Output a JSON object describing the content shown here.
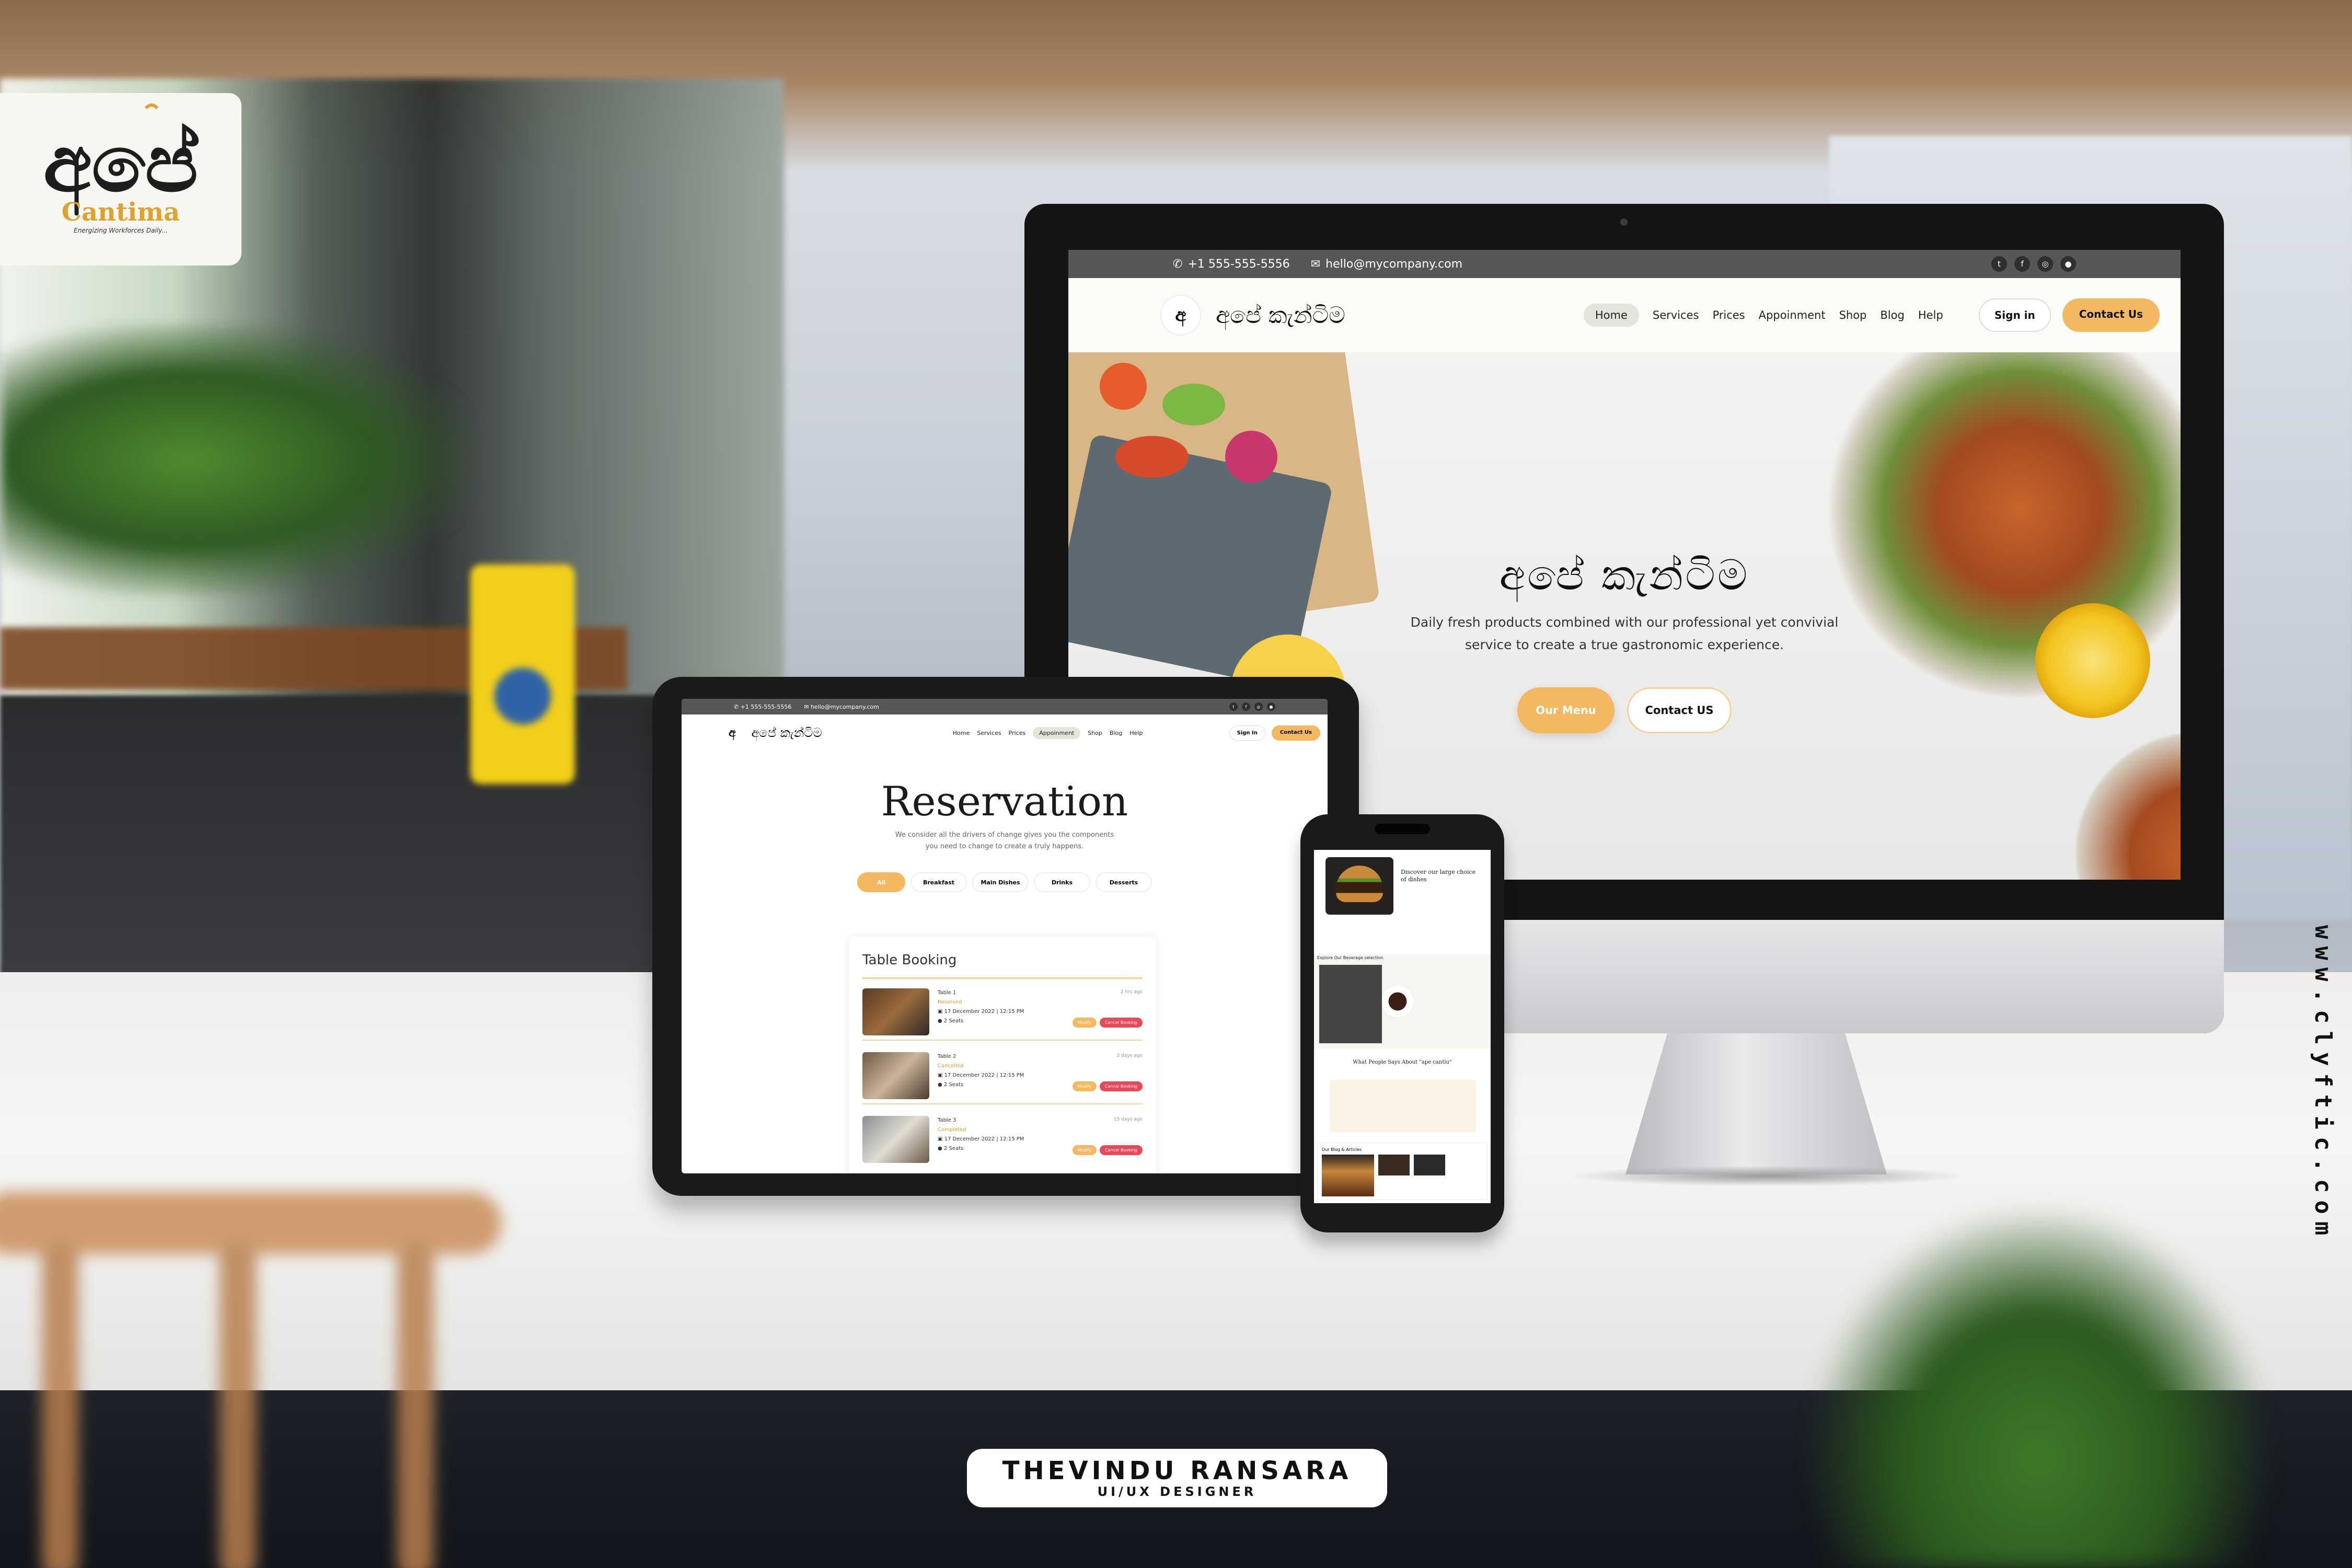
{
  "brand": {
    "glyph": "අපේ",
    "name": "Cantima",
    "tagline": "Energizing Workforces Daily..."
  },
  "side_url": "www.clyftic.com",
  "designer": {
    "name": "THEVINDU RANSARA",
    "role": "UI/UX DESIGNER"
  },
  "desktop": {
    "topbar": {
      "phone": "+1 555-555-5556",
      "email": "hello@mycompany.com",
      "social": [
        "twitter-icon",
        "facebook-icon",
        "instagram-icon",
        "github-icon"
      ]
    },
    "nav": {
      "logo_text": "අපේ කැන්ටිම",
      "items": [
        "Home",
        "Services",
        "Prices",
        "Appoinment",
        "Shop",
        "Blog",
        "Help"
      ],
      "active": "Home",
      "signin": "Sign in",
      "contact": "Contact Us"
    },
    "hero": {
      "title": "අපේ කැන්ටිම",
      "subtitle_line1": "Daily fresh products combined with our professional yet convivial",
      "subtitle_line2": "service to create a true gastronomic experience.",
      "btn_menu": "Our Menu",
      "btn_contact": "Contact US"
    },
    "accent": "#f4b860"
  },
  "tablet": {
    "topbar": {
      "phone": "+1 555-555-5556",
      "email": "hello@mycompany.com"
    },
    "nav": {
      "logo_text": "අපේ කැන්ටිම",
      "items": [
        "Home",
        "Services",
        "Prices",
        "Appoinment",
        "Shop",
        "Blog",
        "Help"
      ],
      "active": "Appoinment",
      "signin": "Sign In",
      "contact": "Contact Us"
    },
    "title": "Reservation",
    "subtitle_line1": "We consider all the drivers of change gives you the components",
    "subtitle_line2": "you need to change to create a truly happens.",
    "tabs": [
      "All",
      "Breakfast",
      "Main Dishes",
      "Drinks",
      "Desserts"
    ],
    "card": {
      "title": "Table Booking",
      "bookings": [
        {
          "table": "Table 1",
          "status": "Reserved",
          "date": "17 December 2022 | 12:15 PM",
          "seats": "2 Seats",
          "ago": "2 hrs ago",
          "modify": "Modify",
          "cancel": "Cancel Booking"
        },
        {
          "table": "Table 2",
          "status": "Cancelled",
          "date": "17 December 2022 | 12:15 PM",
          "seats": "2 Seats",
          "ago": "2 days ago",
          "modify": "Modify",
          "cancel": "Cancel Booking"
        },
        {
          "table": "Table 3",
          "status": "Completed",
          "date": "17 December 2022 | 12:15 PM",
          "seats": "2 Seats",
          "ago": "15 days ago",
          "modify": "Modify",
          "cancel": "Cancel Booking"
        }
      ]
    }
  },
  "phone": {
    "discover": "Discover our large choice of dishes",
    "explore": "Explore Our Beverage selection",
    "people": "What People Says About \"ape cantiu\"",
    "blog": "Our Blog & Articles"
  }
}
